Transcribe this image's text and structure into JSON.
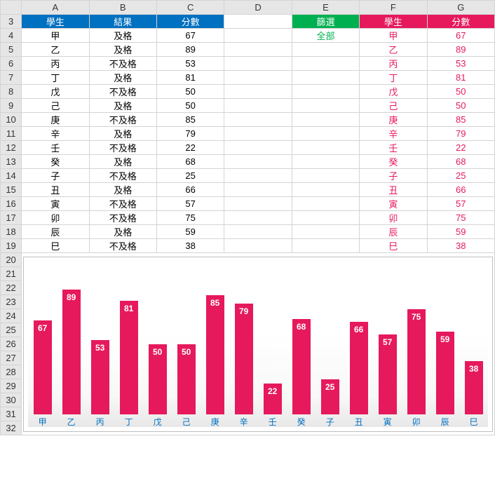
{
  "columns": [
    "A",
    "B",
    "C",
    "D",
    "E",
    "F",
    "G"
  ],
  "rows": [
    3,
    4,
    5,
    6,
    7,
    8,
    9,
    10,
    11,
    12,
    13,
    14,
    15,
    16,
    17,
    18,
    19,
    20,
    21,
    22,
    23,
    24,
    25,
    26,
    27,
    28,
    29,
    30,
    31,
    32
  ],
  "left_header": {
    "student": "學生",
    "result": "結果",
    "score": "分數"
  },
  "filter_header": "篩選",
  "filter_value": "全部",
  "right_header": {
    "student": "學生",
    "score": "分數"
  },
  "students": [
    {
      "name": "甲",
      "result": "及格",
      "score": 67
    },
    {
      "name": "乙",
      "result": "及格",
      "score": 89
    },
    {
      "name": "丙",
      "result": "不及格",
      "score": 53
    },
    {
      "name": "丁",
      "result": "及格",
      "score": 81
    },
    {
      "name": "戊",
      "result": "不及格",
      "score": 50
    },
    {
      "name": "己",
      "result": "及格",
      "score": 50
    },
    {
      "name": "庚",
      "result": "不及格",
      "score": 85
    },
    {
      "name": "辛",
      "result": "及格",
      "score": 79
    },
    {
      "name": "壬",
      "result": "不及格",
      "score": 22
    },
    {
      "name": "癸",
      "result": "及格",
      "score": 68
    },
    {
      "name": "子",
      "result": "不及格",
      "score": 25
    },
    {
      "name": "丑",
      "result": "及格",
      "score": 66
    },
    {
      "name": "寅",
      "result": "不及格",
      "score": 57
    },
    {
      "name": "卯",
      "result": "不及格",
      "score": 75
    },
    {
      "name": "辰",
      "result": "及格",
      "score": 59
    },
    {
      "name": "巳",
      "result": "不及格",
      "score": 38
    }
  ],
  "chart_data": {
    "type": "bar",
    "categories": [
      "甲",
      "乙",
      "丙",
      "丁",
      "戊",
      "己",
      "庚",
      "辛",
      "壬",
      "癸",
      "子",
      "丑",
      "寅",
      "卯",
      "辰",
      "巳"
    ],
    "values": [
      67,
      89,
      53,
      81,
      50,
      50,
      85,
      79,
      22,
      68,
      25,
      66,
      57,
      75,
      59,
      38
    ],
    "ylim": [
      0,
      100
    ],
    "bar_color": "#E6195C",
    "category_label_color": "#0070C0"
  }
}
